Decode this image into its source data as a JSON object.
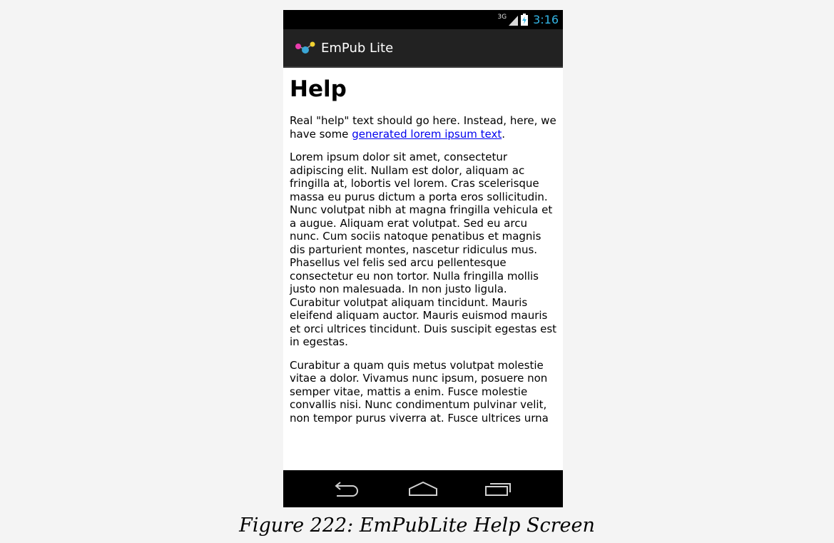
{
  "status_bar": {
    "network_type": "3G",
    "time": "3:16"
  },
  "action_bar": {
    "app_title": "EmPub Lite",
    "icon": "empub-logo-icon"
  },
  "content": {
    "heading": "Help",
    "intro_before_link": "Real \"help\" text should go here. Instead, here, we have some ",
    "intro_link": "generated lorem ipsum text",
    "intro_after_link": ".",
    "paragraphs": [
      "Lorem ipsum dolor sit amet, consectetur adipiscing elit. Nullam est dolor, aliquam ac fringilla at, lobortis vel lorem. Cras scelerisque massa eu purus dictum a porta eros sollicitudin. Nunc volutpat nibh at magna fringilla vehicula et a augue. Aliquam erat volutpat. Sed eu arcu nunc. Cum sociis natoque penatibus et magnis dis parturient montes, nascetur ridiculus mus. Phasellus vel felis sed arcu pellentesque consectetur eu non tortor. Nulla fringilla mollis justo non malesuada. In non justo ligula. Curabitur volutpat aliquam tincidunt. Mauris eleifend aliquam auctor. Mauris euismod mauris et orci ultrices tincidunt. Duis suscipit egestas est in egestas.",
      "Curabitur a quam quis metus volutpat molestie vitae a dolor. Vivamus nunc ipsum, posuere non semper vitae, mattis a enim. Fusce molestie convallis nisi. Nunc condimentum pulvinar velit, non tempor purus viverra at. Fusce ultrices urna"
    ]
  },
  "nav_bar": {
    "buttons": [
      "back-icon",
      "home-icon",
      "recents-icon"
    ]
  },
  "caption": "Figure 222: EmPubLite Help Screen",
  "colors": {
    "status_time": "#33b5e5",
    "action_bar_bg": "#222222",
    "link": "#0000ee"
  }
}
